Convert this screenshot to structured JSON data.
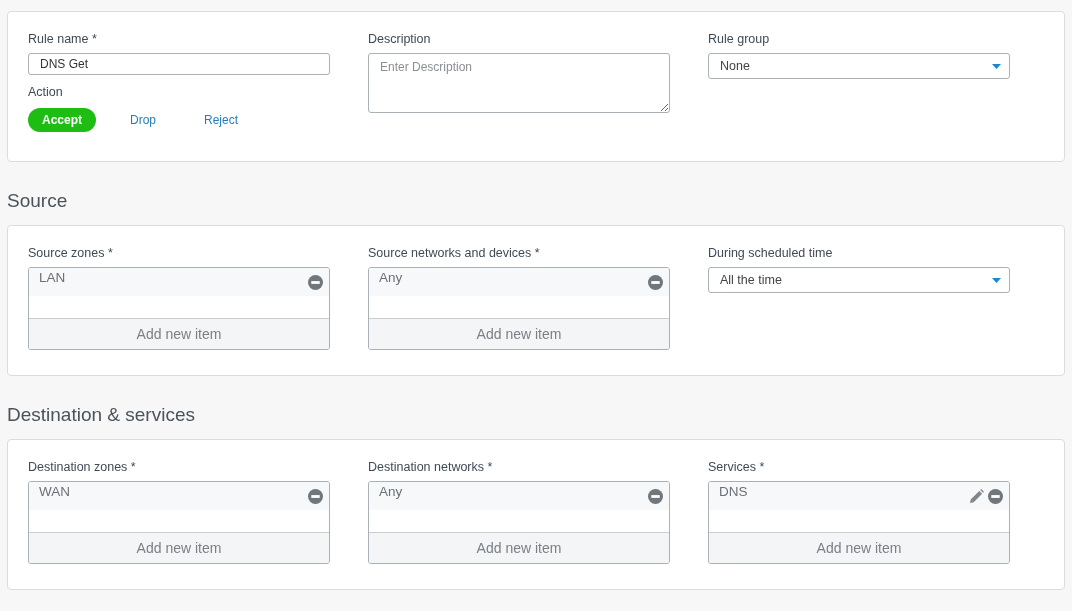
{
  "cards": [
    {
      "columns": [
        [
          {
            "kind": "text",
            "label": "Rule name *",
            "value": "DNS Get"
          },
          {
            "kind": "action",
            "label": "Action",
            "options": [
              {
                "label": "Accept",
                "selected": true
              },
              {
                "label": "Drop",
                "selected": false
              },
              {
                "label": "Reject",
                "selected": false
              }
            ]
          }
        ],
        [
          {
            "kind": "textarea",
            "label": "Description",
            "placeholder": "Enter Description"
          }
        ],
        [
          {
            "kind": "select",
            "label": "Rule group",
            "value": "None"
          }
        ]
      ]
    },
    {
      "title": "Source",
      "columns": [
        [
          {
            "kind": "list",
            "label": "Source zones *",
            "items": [
              {
                "label": "LAN",
                "editable": false
              }
            ],
            "add": "Add new item"
          }
        ],
        [
          {
            "kind": "list",
            "label": "Source networks and devices *",
            "items": [
              {
                "label": "Any",
                "editable": false
              }
            ],
            "add": "Add new item"
          }
        ],
        [
          {
            "kind": "select",
            "label": "During scheduled time",
            "value": "All the time"
          }
        ]
      ]
    },
    {
      "title": "Destination & services",
      "columns": [
        [
          {
            "kind": "list",
            "label": "Destination zones *",
            "items": [
              {
                "label": "WAN",
                "editable": false
              }
            ],
            "add": "Add new item"
          }
        ],
        [
          {
            "kind": "list",
            "label": "Destination networks *",
            "items": [
              {
                "label": "Any",
                "editable": false
              }
            ],
            "add": "Add new item"
          }
        ],
        [
          {
            "kind": "list",
            "label": "Services *",
            "items": [
              {
                "label": "DNS",
                "editable": true
              }
            ],
            "add": "Add new item"
          }
        ]
      ]
    }
  ]
}
